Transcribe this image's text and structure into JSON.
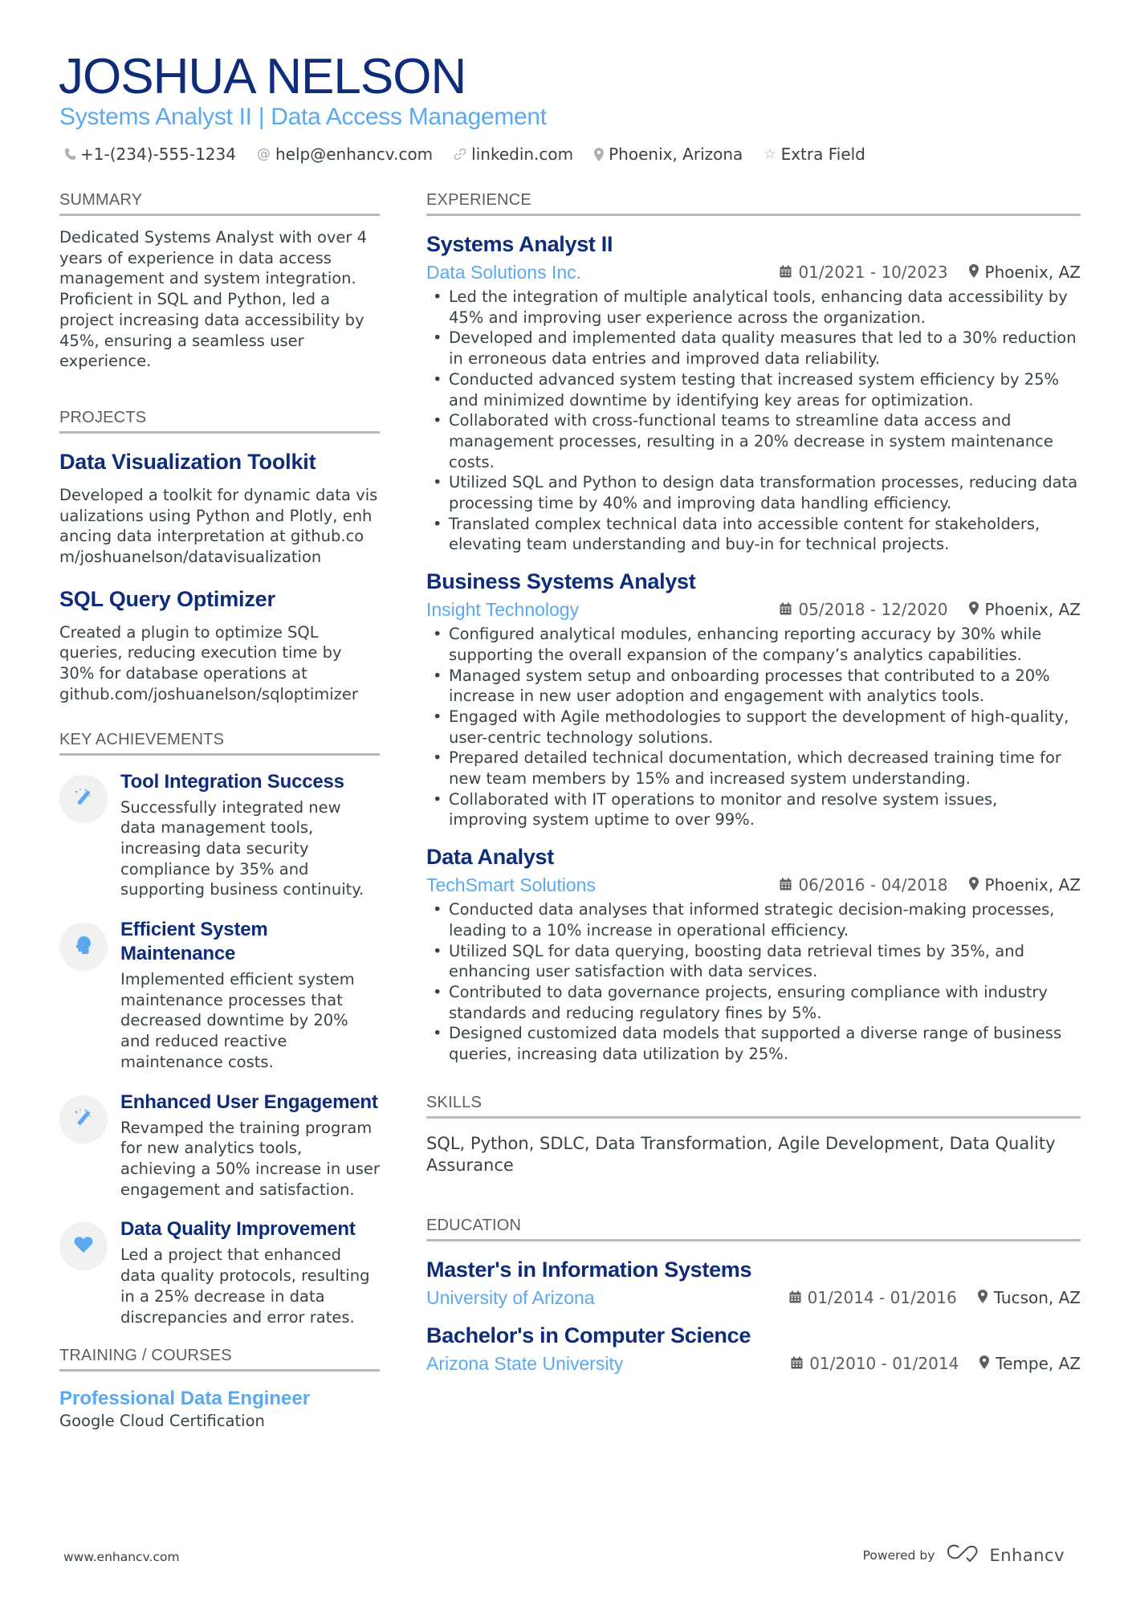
{
  "header": {
    "name": "JOSHUA NELSON",
    "title": "Systems Analyst II | Data Access Management",
    "contacts": [
      {
        "icon": "phone-icon",
        "text": "+1-(234)-555-1234"
      },
      {
        "icon": "at-icon",
        "text": "help@enhancv.com"
      },
      {
        "icon": "link-icon",
        "text": "linkedin.com"
      },
      {
        "icon": "location-pin-icon",
        "text": "Phoenix, Arizona"
      },
      {
        "icon": "star-icon",
        "text": "Extra Field"
      }
    ]
  },
  "summary": {
    "heading": "SUMMARY",
    "text": "Dedicated Systems Analyst with over 4 years of experience in data access management and system integration. Proficient in SQL and Python, led a project increasing data accessibility by 45%, ensuring a seamless user experience."
  },
  "projects": {
    "heading": "PROJECTS",
    "items": [
      {
        "title": "Data Visualization Toolkit",
        "description": "Developed a toolkit for dynamic data visualizations using Python and Plotly, enhancing data interpretation at github.com/joshuanelson/datavisualization"
      },
      {
        "title": "SQL Query Optimizer",
        "description": "Created a plugin to optimize SQL queries, reducing execution time by 30% for database operations at github.com/joshuanelson/sqloptimizer"
      }
    ]
  },
  "achievements": {
    "heading": "KEY ACHIEVEMENTS",
    "items": [
      {
        "icon": "magic-wand-icon",
        "title": "Tool Integration Success",
        "description": "Successfully integrated new data management tools, increasing data security compliance by 35% and supporting business continuity."
      },
      {
        "icon": "head-brain-icon",
        "title": "Efficient System Maintenance",
        "description": "Implemented efficient system maintenance processes that decreased downtime by 20% and reduced reactive maintenance costs."
      },
      {
        "icon": "magic-wand-icon",
        "title": "Enhanced User Engagement",
        "description": "Revamped the training program for new analytics tools, achieving a 50% increase in user engagement and satisfaction."
      },
      {
        "icon": "heart-icon",
        "title": "Data Quality Improvement",
        "description": "Led a project that enhanced data quality protocols, resulting in a 25% decrease in data discrepancies and error rates."
      }
    ]
  },
  "training": {
    "heading": "TRAINING / COURSES",
    "items": [
      {
        "title": "Professional Data Engineer",
        "subtitle": "Google Cloud Certification"
      }
    ]
  },
  "experience": {
    "heading": "EXPERIENCE",
    "jobs": [
      {
        "title": "Systems Analyst II",
        "company": "Data Solutions Inc.",
        "dates": "01/2021 - 10/2023",
        "location": "Phoenix, AZ",
        "bullets": [
          "Led the integration of multiple analytical tools, enhancing data accessibility by 45% and improving user experience across the organization.",
          "Developed and implemented data quality measures that led to a 30% reduction in erroneous data entries and improved data reliability.",
          "Conducted advanced system testing that increased system efficiency by 25% and minimized downtime by identifying key areas for optimization.",
          "Collaborated with cross-functional teams to streamline data access and management processes, resulting in a 20% decrease in system maintenance costs.",
          "Utilized SQL and Python to design data transformation processes, reducing data processing time by 40% and improving data handling efficiency.",
          "Translated complex technical data into accessible content for stakeholders, elevating team understanding and buy-in for technical projects."
        ]
      },
      {
        "title": "Business Systems Analyst",
        "company": "Insight Technology",
        "dates": "05/2018 - 12/2020",
        "location": "Phoenix, AZ",
        "bullets": [
          "Configured analytical modules, enhancing reporting accuracy by 30% while supporting the overall expansion of the company’s analytics capabilities.",
          "Managed system setup and onboarding processes that contributed to a 20% increase in new user adoption and engagement with analytics tools.",
          "Engaged with Agile methodologies to support the development of high-quality, user-centric technology solutions.",
          "Prepared detailed technical documentation, which decreased training time for new team members by 15% and increased system understanding.",
          "Collaborated with IT operations to monitor and resolve system issues, improving system uptime to over 99%."
        ]
      },
      {
        "title": "Data Analyst",
        "company": "TechSmart Solutions",
        "dates": "06/2016 - 04/2018",
        "location": "Phoenix, AZ",
        "bullets": [
          "Conducted data analyses that informed strategic decision-making processes, leading to a 10% increase in operational efficiency.",
          "Utilized SQL for data querying, boosting data retrieval times by 35%, and enhancing user satisfaction with data services.",
          "Contributed to data governance projects, ensuring compliance with industry standards and reducing regulatory fines by 5%.",
          "Designed customized data models that supported a diverse range of business queries, increasing data utilization by 25%."
        ]
      }
    ]
  },
  "skills": {
    "heading": "SKILLS",
    "text": "SQL, Python, SDLC, Data Transformation, Agile Development, Data Quality Assurance"
  },
  "education": {
    "heading": "EDUCATION",
    "items": [
      {
        "degree": "Master's in Information Systems",
        "school": "University of Arizona",
        "dates": "01/2014 - 01/2016",
        "location": "Tucson, AZ"
      },
      {
        "degree": "Bachelor's in Computer Science",
        "school": "Arizona State University",
        "dates": "01/2010 - 01/2014",
        "location": "Tempe, AZ"
      }
    ]
  },
  "footer": {
    "website": "www.enhancv.com",
    "powered_by": "Powered by",
    "brand": "Enhancv"
  },
  "colors": {
    "name": "#0f2c7b",
    "accent": "#5aa9f0",
    "text": "#384347",
    "rule": "#b7babc",
    "icon_circle": "#f1f1f2"
  }
}
